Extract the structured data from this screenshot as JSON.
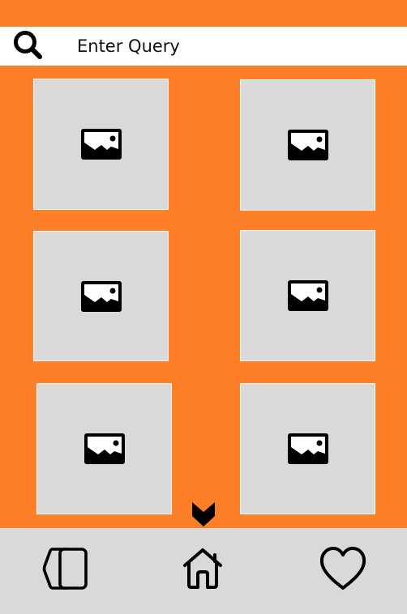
{
  "colors": {
    "background": "#FF7F28",
    "search_bar": "#FFFFFF",
    "tile": "#D9D9D9",
    "tile_border": "#FFFFFF",
    "bottom_nav": "#D9D9D9",
    "icon": "#000000"
  },
  "search": {
    "icon": "search-icon",
    "placeholder": "Enter Query"
  },
  "gallery": {
    "tiles": [
      {
        "icon": "image-placeholder-icon"
      },
      {
        "icon": "image-placeholder-icon"
      },
      {
        "icon": "image-placeholder-icon"
      },
      {
        "icon": "image-placeholder-icon"
      },
      {
        "icon": "image-placeholder-icon"
      },
      {
        "icon": "image-placeholder-icon"
      }
    ],
    "more_icon": "chevron-down-icon"
  },
  "bottom_nav": {
    "items": [
      {
        "icon": "cards-icon"
      },
      {
        "icon": "home-icon"
      },
      {
        "icon": "heart-icon"
      }
    ]
  }
}
